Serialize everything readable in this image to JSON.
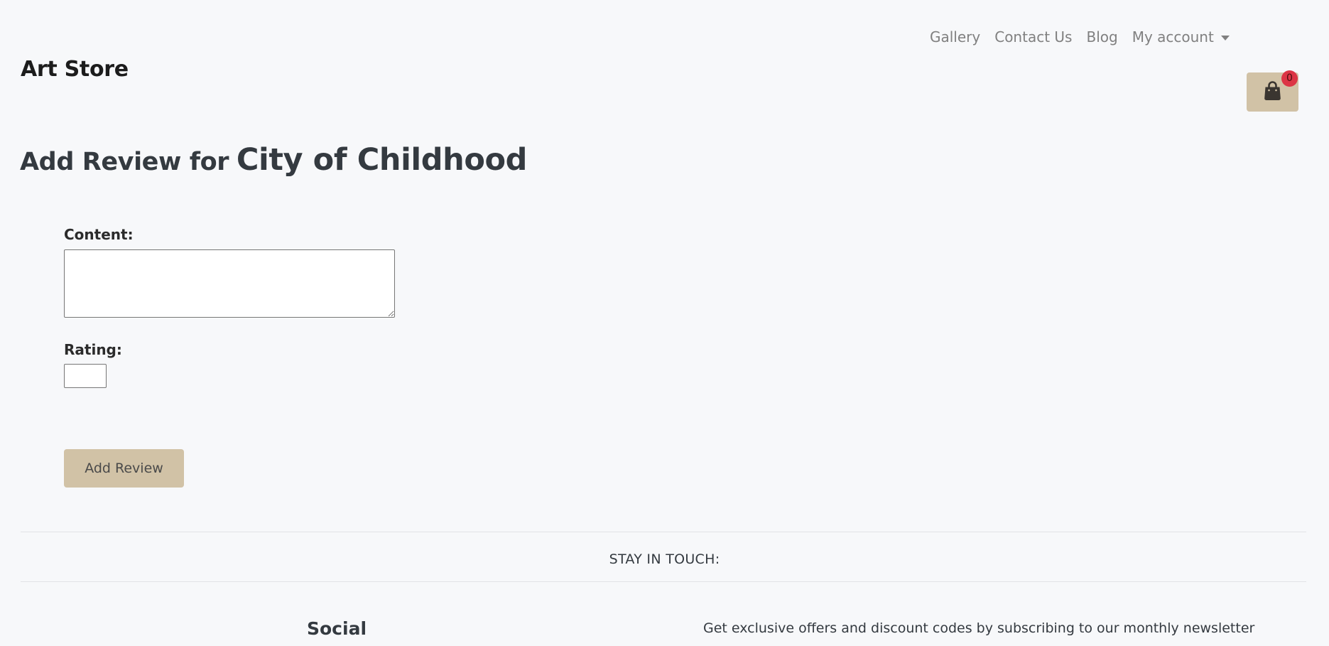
{
  "header": {
    "brand": "Art Store",
    "nav": {
      "gallery": "Gallery",
      "contact": "Contact Us",
      "blog": "Blog",
      "account": "My account"
    },
    "cart": {
      "icon": "shopping-bag-icon",
      "count": "0"
    }
  },
  "page": {
    "title_prefix": "Add Review for",
    "product_name": "City of Childhood"
  },
  "form": {
    "content_label": "Content:",
    "content_value": "",
    "rating_label": "Rating:",
    "rating_value": "",
    "submit_label": "Add Review"
  },
  "footer": {
    "stay_in_touch": "STAY IN TOUCH:",
    "social_heading": "Social",
    "newsletter_text": "Get exclusive offers and discount codes by subscribing to our monthly newsletter"
  },
  "colors": {
    "background": "#f7f8fa",
    "accent": "#d1c2a6",
    "badge": "#dc3545",
    "nav_text": "#808080",
    "heading": "#343a40"
  }
}
